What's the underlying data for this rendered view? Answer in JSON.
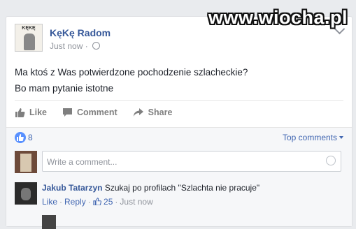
{
  "watermark": "www.wiocha.pl",
  "post": {
    "author": "KęKę Radom",
    "avatar_label": "KĘKĘ",
    "timestamp": "Just now",
    "lines": [
      "Ma ktoś z Was potwierdzone pochodzenie szlacheckie?",
      "Bo mam pytanie istotne"
    ]
  },
  "actions": {
    "like": "Like",
    "comment": "Comment",
    "share": "Share"
  },
  "reactions": {
    "like_count": "8",
    "top_comments": "Top comments"
  },
  "composer": {
    "placeholder": "Write a comment..."
  },
  "comments": [
    {
      "author": "Jakub Tatarzyn",
      "text": "Szukaj po profilach \"Szlachta nie pracuje\"",
      "like_label": "Like",
      "reply_label": "Reply",
      "likes": "25",
      "time": "Just now"
    }
  ],
  "colors": {
    "link": "#365899",
    "accent": "#4267b2",
    "like_badge": "#5890ff"
  },
  "icons": [
    "chevron-down-icon",
    "globe-icon",
    "thumbs-up-icon",
    "comment-icon",
    "share-icon",
    "smiley-icon"
  ]
}
